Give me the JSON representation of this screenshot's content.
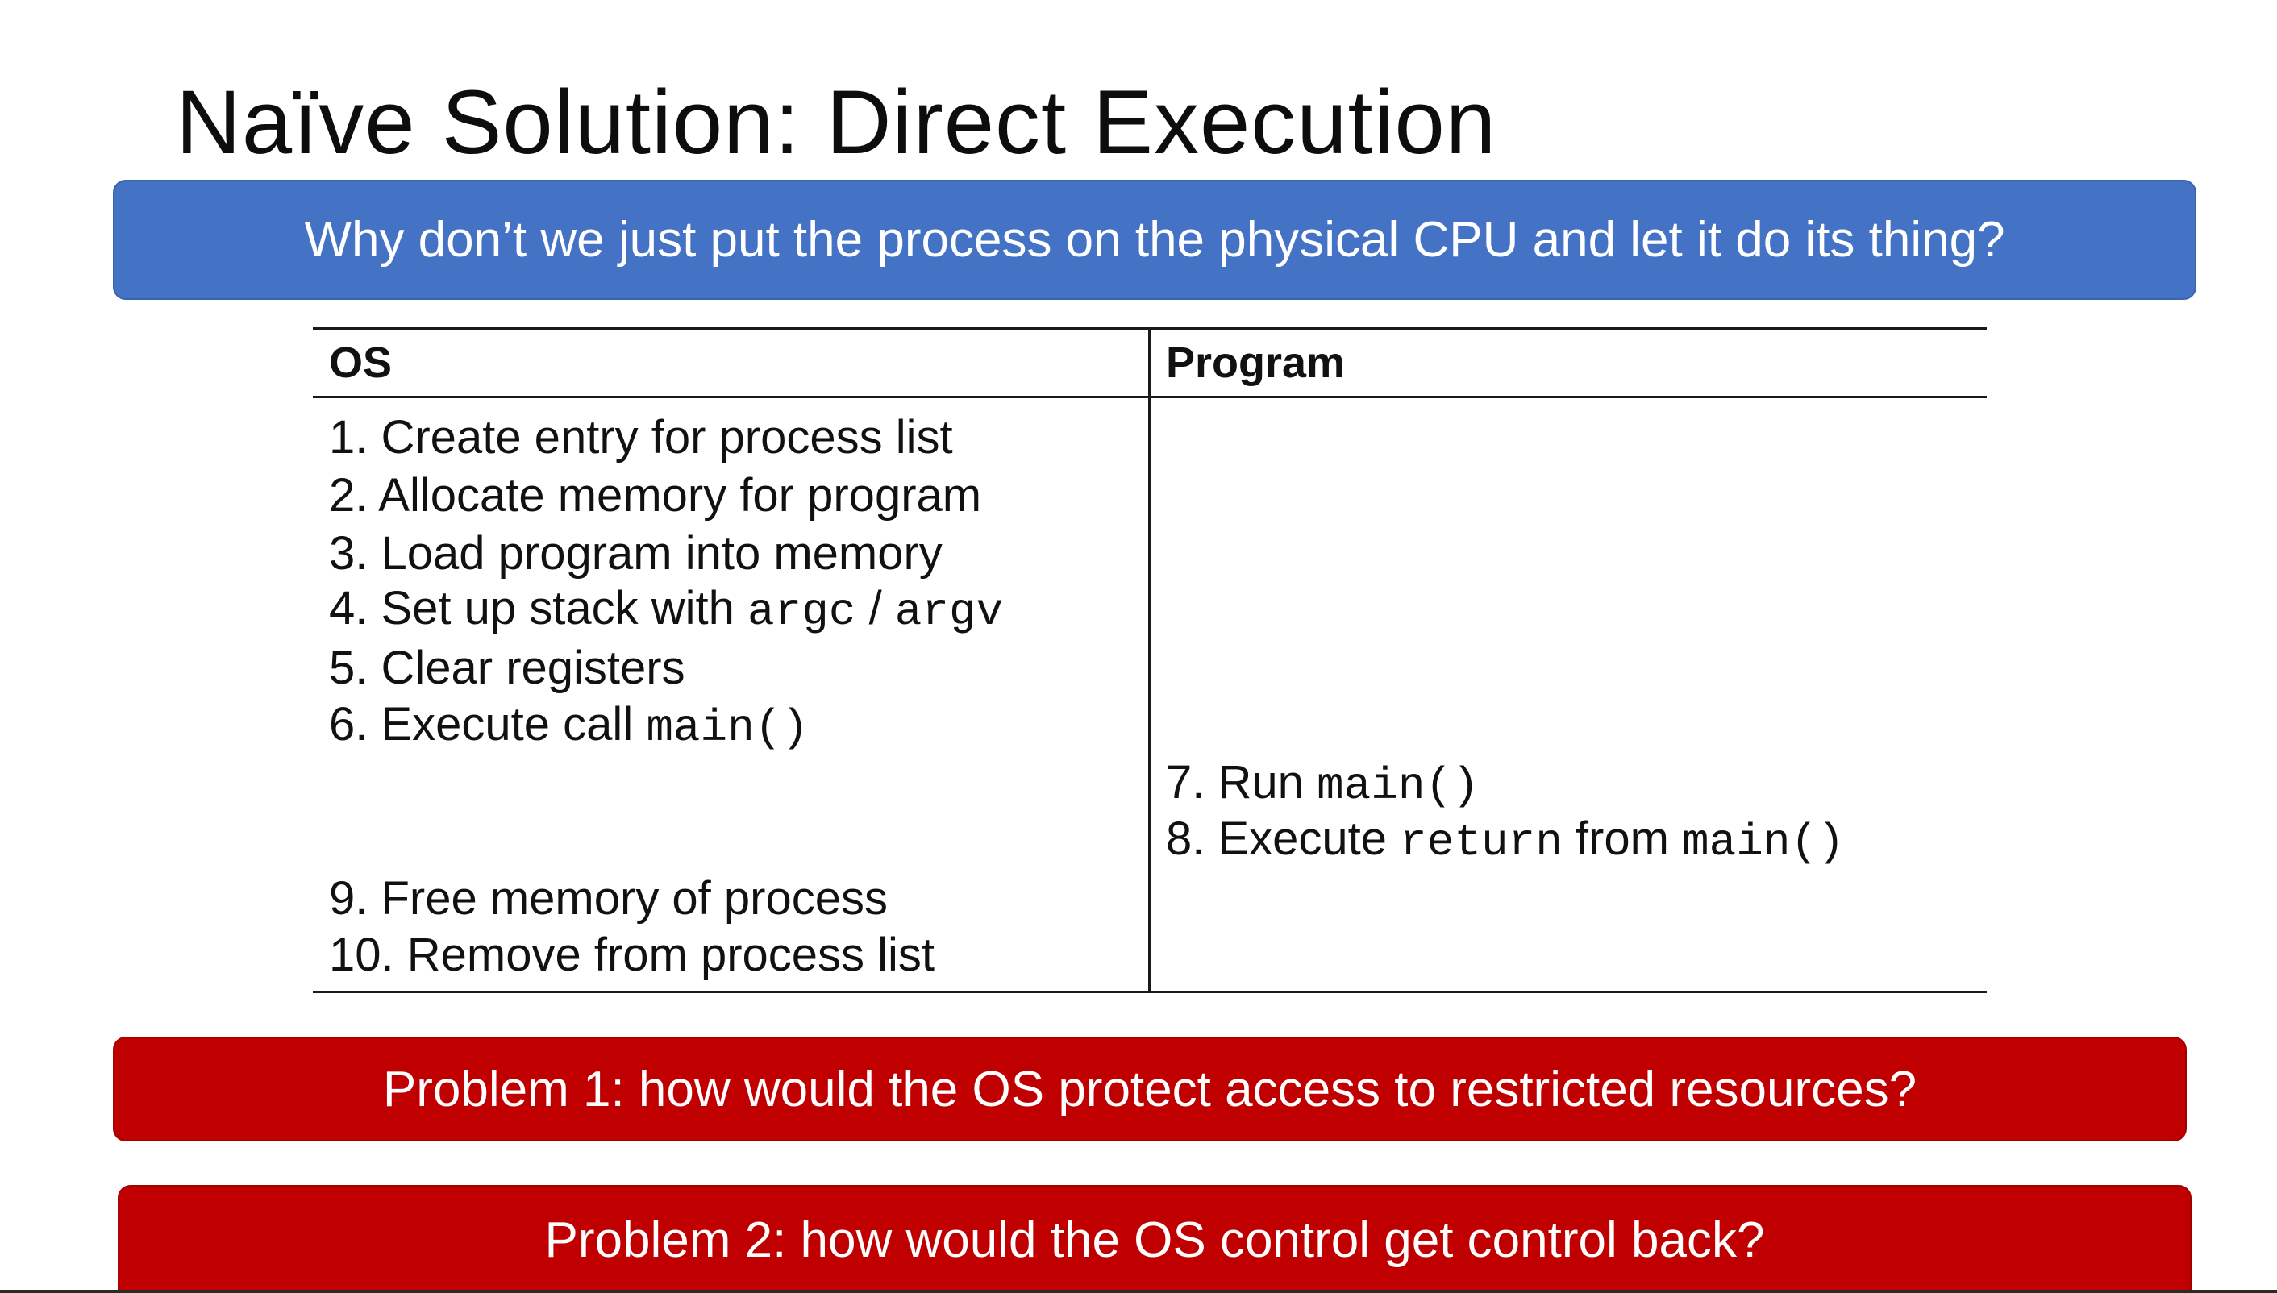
{
  "title": "Naïve Solution: Direct Execution",
  "question_banner": "Why don’t we just put the process on the physical CPU and let it do its thing?",
  "table": {
    "headers": {
      "os": "OS",
      "program": "Program"
    },
    "os_steps": [
      {
        "prefix": "1. Create entry for process list"
      },
      {
        "prefix": "2. Allocate memory for program"
      },
      {
        "prefix": "3. Load program into memory"
      },
      {
        "prefix": "4. Set up stack with ",
        "code1": "argc",
        "mid": " / ",
        "code2": "argv"
      },
      {
        "prefix": "5. Clear registers"
      },
      {
        "prefix": "6. Execute call ",
        "code1": "main()"
      },
      {
        "prefix": "9. Free memory of process"
      },
      {
        "prefix": "10. Remove from process list"
      }
    ],
    "program_steps": [
      {
        "prefix": "7. Run ",
        "code1": "main()"
      },
      {
        "prefix": "8. Execute ",
        "code1": "return",
        "mid": " from ",
        "code2": "main()"
      }
    ]
  },
  "problem_1": "Problem 1: how would the OS protect access to restricted resources?",
  "problem_2": "Problem 2: how would the OS control get control back?",
  "colors": {
    "question_banner_bg": "#4472c4",
    "problem_banner_bg": "#c00000",
    "banner_text": "#ffffff"
  }
}
